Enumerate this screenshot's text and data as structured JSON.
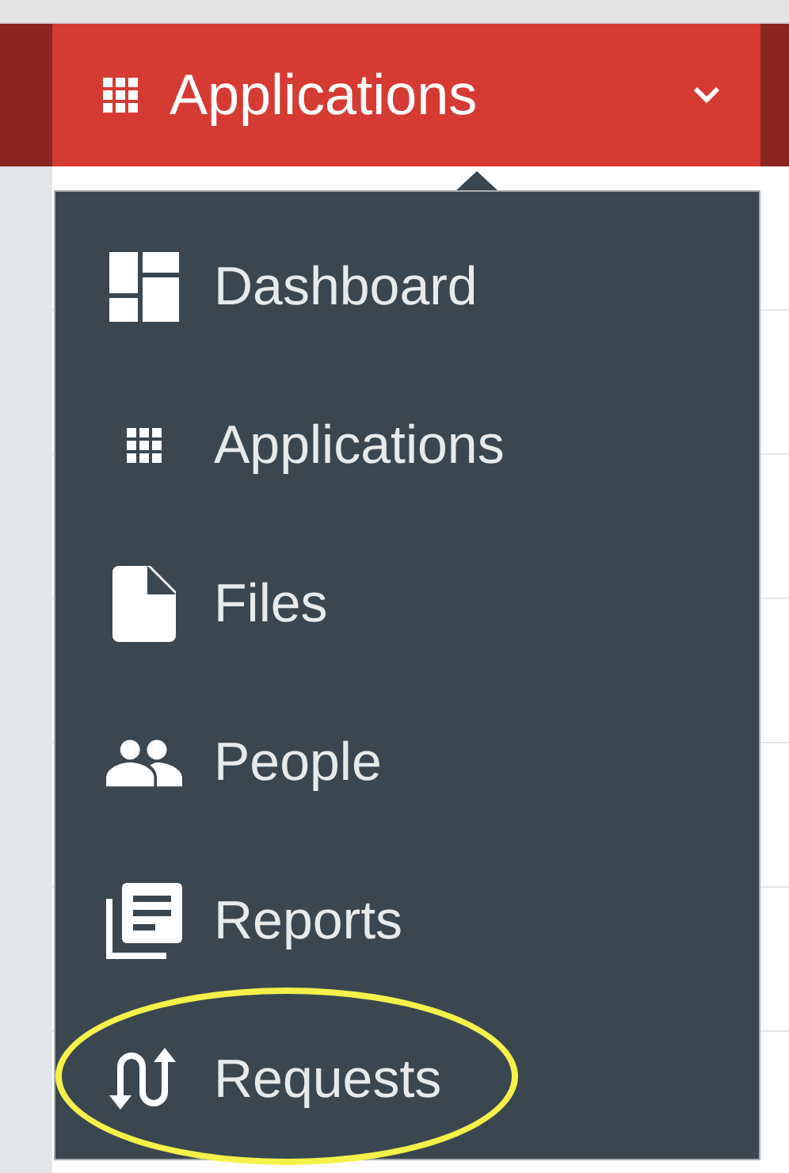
{
  "header": {
    "title": "Applications",
    "expanded": true
  },
  "menu": [
    {
      "label": "Dashboard",
      "kind": "dashboard",
      "highlighted": false
    },
    {
      "label": "Applications",
      "kind": "grid",
      "highlighted": false
    },
    {
      "label": "Files",
      "kind": "file",
      "highlighted": false
    },
    {
      "label": "People",
      "kind": "people",
      "highlighted": false
    },
    {
      "label": "Reports",
      "kind": "reports",
      "highlighted": false
    },
    {
      "label": "Requests",
      "kind": "requests",
      "highlighted": true
    }
  ]
}
